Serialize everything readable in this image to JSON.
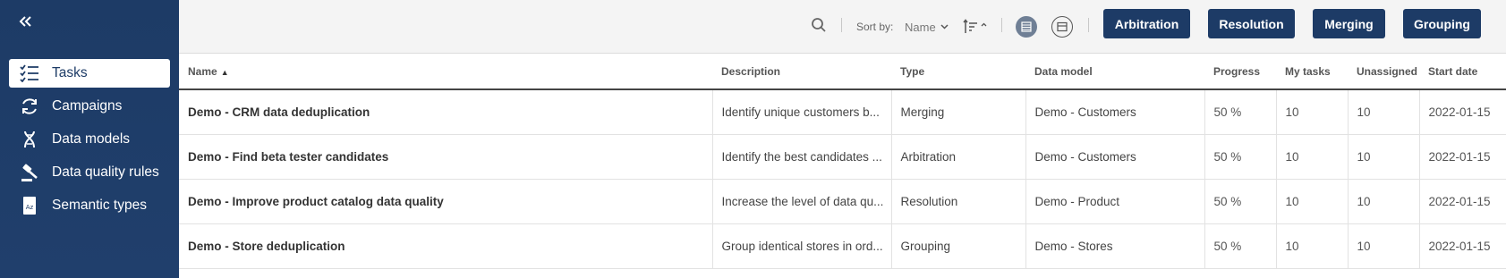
{
  "sidebar": {
    "collapse_icon": "double-chevron-left-icon",
    "items": [
      {
        "label": "Tasks",
        "icon": "checklist-icon",
        "active": true
      },
      {
        "label": "Campaigns",
        "icon": "cycle-icon",
        "active": false
      },
      {
        "label": "Data models",
        "icon": "dna-icon",
        "active": false
      },
      {
        "label": "Data quality rules",
        "icon": "gavel-icon",
        "active": false
      },
      {
        "label": "Semantic types",
        "icon": "semantic-doc-icon",
        "active": false
      }
    ]
  },
  "toolbar": {
    "search_icon": "search-icon",
    "sort_label": "Sort by:",
    "sort_value": "Name",
    "sort_direction_icon": "sort-ascending-icon",
    "view_icons": [
      "list-view-icon",
      "card-view-icon"
    ],
    "type_buttons": [
      "Arbitration",
      "Resolution",
      "Merging",
      "Grouping"
    ]
  },
  "table": {
    "columns": [
      "Name",
      "Description",
      "Type",
      "Data model",
      "Progress",
      "My tasks",
      "Unassigned",
      "Start date"
    ],
    "sorted_column": "Name",
    "rows": [
      [
        "Demo - CRM data deduplication",
        "Identify unique customers b...",
        "Merging",
        "Demo - Customers",
        "50 %",
        "10",
        "10",
        "2022-01-15"
      ],
      [
        "Demo - Find beta tester candidates",
        "Identify the best candidates ...",
        "Arbitration",
        "Demo - Customers",
        "50 %",
        "10",
        "10",
        "2022-01-15"
      ],
      [
        "Demo - Improve product catalog data quality",
        "Increase the level of data qu...",
        "Resolution",
        "Demo - Product",
        "50 %",
        "10",
        "10",
        "2022-01-15"
      ],
      [
        "Demo - Store deduplication",
        "Group identical stores in ord...",
        "Grouping",
        "Demo - Stores",
        "50 %",
        "10",
        "10",
        "2022-01-15"
      ]
    ]
  },
  "colors": {
    "brand": "#1d3b66",
    "sidebar_bg": "#1f3d6a",
    "toolbar_bg": "#f4f4f4"
  }
}
